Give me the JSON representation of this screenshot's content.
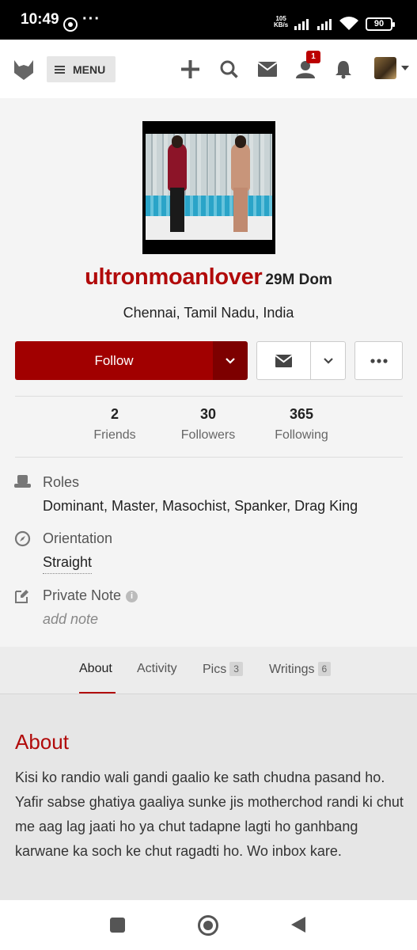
{
  "status_bar": {
    "time": "10:49",
    "dots": "···",
    "speed_value": "105",
    "speed_unit": "KB/s",
    "battery": "90"
  },
  "header": {
    "menu_label": "MENU",
    "notification_count": "1",
    "icons": [
      "logo-icon",
      "plus-icon",
      "search-icon",
      "mail-icon",
      "friend-requests-icon",
      "bell-icon",
      "avatar"
    ]
  },
  "profile": {
    "username": "ultronmoanlover",
    "meta": "29M Dom",
    "location": "Chennai, Tamil Nadu, India",
    "follow_label": "Follow",
    "accent_color": "#a10000",
    "stats": [
      {
        "num": "2",
        "label": "Friends"
      },
      {
        "num": "30",
        "label": "Followers"
      },
      {
        "num": "365",
        "label": "Following"
      }
    ],
    "roles_label": "Roles",
    "roles_value": "Dominant, Master, Masochist, Spanker, Drag King",
    "orientation_label": "Orientation",
    "orientation_value": "Straight",
    "private_note_label": "Private Note",
    "info_glyph": "i",
    "add_note": "add note"
  },
  "tabs": [
    {
      "label": "About",
      "count": ""
    },
    {
      "label": "Activity",
      "count": ""
    },
    {
      "label": "Pics",
      "count": "3"
    },
    {
      "label": "Writings",
      "count": "6"
    }
  ],
  "about": {
    "title": "About",
    "text": "Kisi ko randio wali gandi gaalio ke sath chudna pasand ho. Yafir sabse ghatiya gaaliya sunke jis motherchod randi ki chut me aag lag jaati ho ya chut tadapne lagti ho ganhbang karwane ka soch ke chut ragadti ho. Wo inbox kare."
  }
}
